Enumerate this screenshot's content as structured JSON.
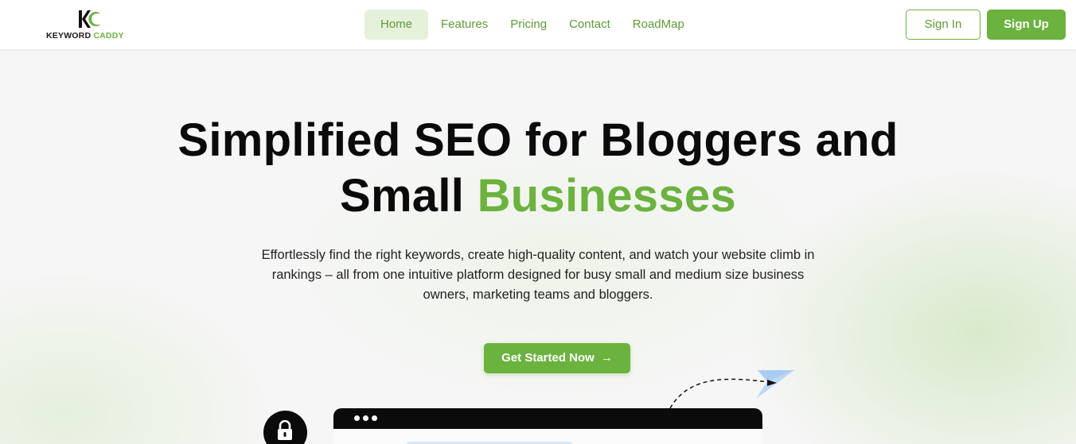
{
  "brand": {
    "name_part1": "KEYWORD",
    "name_part2": "CADDY",
    "accent_color": "#6cb23f"
  },
  "nav": {
    "items": [
      {
        "label": "Home",
        "active": true
      },
      {
        "label": "Features",
        "active": false
      },
      {
        "label": "Pricing",
        "active": false
      },
      {
        "label": "Contact",
        "active": false
      },
      {
        "label": "RoadMap",
        "active": false
      }
    ],
    "sign_in": "Sign In",
    "sign_up": "Sign Up"
  },
  "hero": {
    "title_line1": "Simplified SEO for Bloggers and",
    "title_line2_plain": "Small",
    "title_line2_accent": "Businesses",
    "subtitle": "Effortlessly find the right keywords, create high-quality content, and watch your website climb in rankings – all from one intuitive platform designed for busy small and medium size business owners, marketing teams and bloggers.",
    "cta_label": "Get Started Now",
    "cta_arrow": "→"
  },
  "decor": {
    "lock_icon": "lock-icon",
    "plane_icon": "paper-plane-icon"
  }
}
